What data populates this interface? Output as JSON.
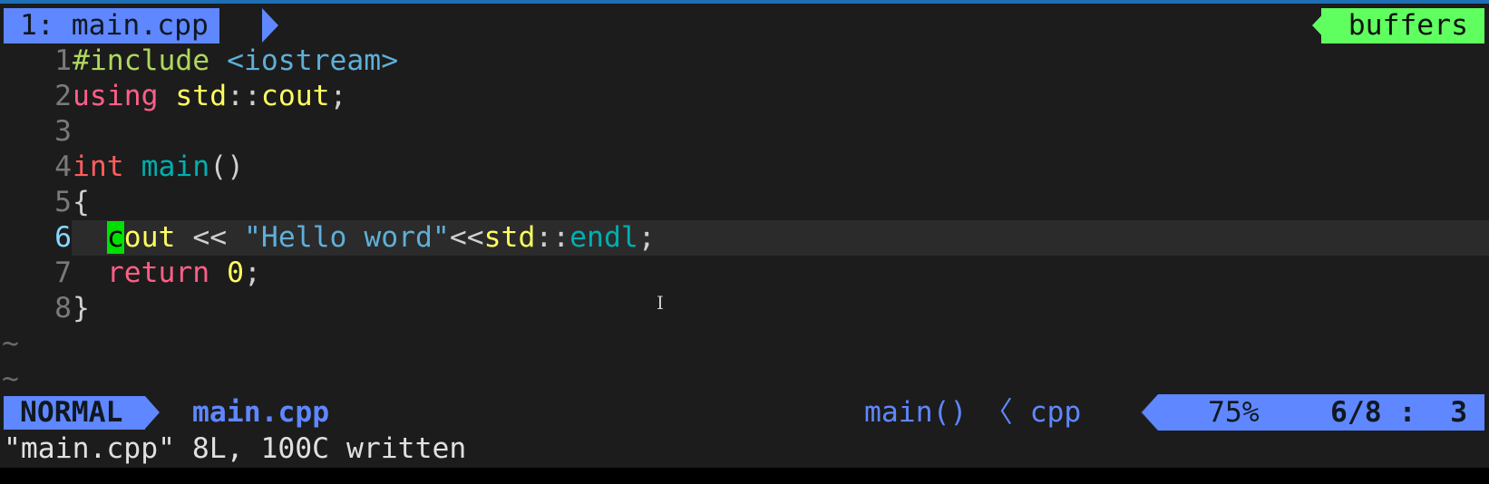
{
  "tabline": {
    "tab_label": "1: main.cpp",
    "buffers_label": "buffers"
  },
  "editor": {
    "lines": [
      {
        "number": "1",
        "tokens": [
          {
            "t": "#include",
            "c": "pre"
          },
          {
            "t": " ",
            "c": "p"
          },
          {
            "t": "<iostream>",
            "c": "inc"
          }
        ]
      },
      {
        "number": "2",
        "tokens": [
          {
            "t": "using",
            "c": "kw"
          },
          {
            "t": " ",
            "c": "p"
          },
          {
            "t": "std",
            "c": "ns"
          },
          {
            "t": "::",
            "c": "p"
          },
          {
            "t": "cout",
            "c": "ns"
          },
          {
            "t": ";",
            "c": "p"
          }
        ]
      },
      {
        "number": "3",
        "tokens": []
      },
      {
        "number": "4",
        "tokens": [
          {
            "t": "int",
            "c": "type"
          },
          {
            "t": " ",
            "c": "p"
          },
          {
            "t": "main",
            "c": "fn"
          },
          {
            "t": "()",
            "c": "p"
          }
        ]
      },
      {
        "number": "5",
        "tokens": [
          {
            "t": "{",
            "c": "p"
          }
        ]
      },
      {
        "number": "6",
        "current": true,
        "tokens": [
          {
            "t": "  ",
            "c": "p"
          },
          {
            "t": "c",
            "c": "cursor"
          },
          {
            "t": "out",
            "c": "ns"
          },
          {
            "t": " << ",
            "c": "p"
          },
          {
            "t": "\"Hello word\"",
            "c": "str"
          },
          {
            "t": "<<",
            "c": "p"
          },
          {
            "t": "std",
            "c": "ns"
          },
          {
            "t": "::",
            "c": "p"
          },
          {
            "t": "endl",
            "c": "fn"
          },
          {
            "t": ";",
            "c": "p"
          }
        ]
      },
      {
        "number": "7",
        "tokens": [
          {
            "t": "  ",
            "c": "p"
          },
          {
            "t": "return",
            "c": "kw"
          },
          {
            "t": " ",
            "c": "p"
          },
          {
            "t": "0",
            "c": "num"
          },
          {
            "t": ";",
            "c": "p"
          }
        ]
      },
      {
        "number": "8",
        "tokens": [
          {
            "t": "}",
            "c": "p"
          }
        ]
      }
    ],
    "empty_marker": "~",
    "empty_rows": 2
  },
  "statusline": {
    "mode": "NORMAL",
    "filename": "main.cpp",
    "function": "main() 〈 cpp",
    "percent": "75%",
    "line_col": "6/8 :  3"
  },
  "cmdline": {
    "message": "\"main.cpp\" 8L, 100C written"
  },
  "colors": {
    "accent": "#5f87ff",
    "buffers": "#5fff5f",
    "background": "#1c1c1c",
    "cursor": "#00e000"
  }
}
